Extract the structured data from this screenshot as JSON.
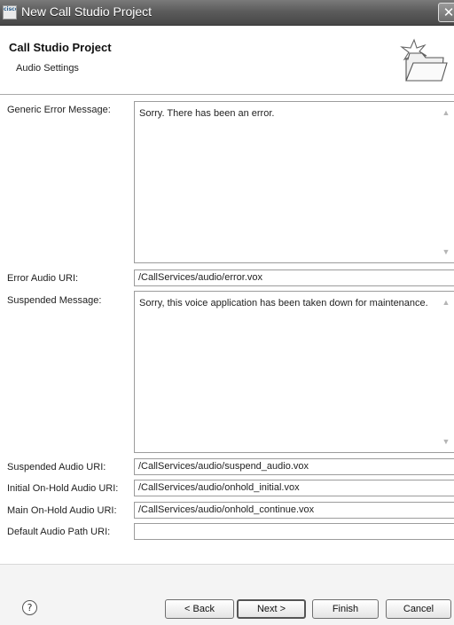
{
  "window": {
    "title": "New Call Studio Project",
    "app_icon_text": "cisco",
    "close_glyph": "✕"
  },
  "header": {
    "title": "Call Studio Project",
    "subtitle": "Audio Settings",
    "icon": "folder-wizard-icon"
  },
  "form": {
    "generic_error": {
      "label": "Generic Error Message:",
      "value": "Sorry. There has been an error."
    },
    "error_audio_uri": {
      "label": "Error Audio URI:",
      "value": "/CallServices/audio/error.vox"
    },
    "suspended_message": {
      "label": "Suspended Message:",
      "value": "Sorry, this voice application has been taken down for maintenance."
    },
    "suspended_audio_uri": {
      "label": "Suspended Audio URI:",
      "value": "/CallServices/audio/suspend_audio.vox"
    },
    "initial_onhold_uri": {
      "label": "Initial On-Hold Audio URI:",
      "value": "/CallServices/audio/onhold_initial.vox"
    },
    "main_onhold_uri": {
      "label": "Main On-Hold Audio URI:",
      "value": "/CallServices/audio/onhold_continue.vox"
    },
    "default_audio_path_uri": {
      "label": "Default Audio Path URI:",
      "value": ""
    }
  },
  "footer": {
    "help_glyph": "?",
    "back_label": "< Back",
    "next_label": "Next >",
    "finish_label": "Finish",
    "cancel_label": "Cancel"
  }
}
